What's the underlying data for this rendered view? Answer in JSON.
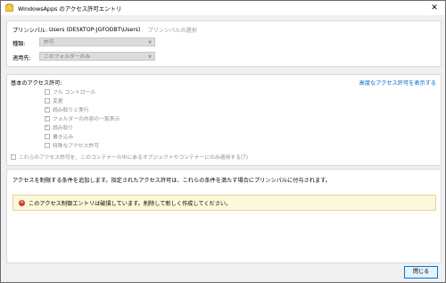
{
  "window": {
    "title": "WindowsApps のアクセス許可エントリ",
    "close_glyph": "✕"
  },
  "principal": {
    "label": "プリンシパル:",
    "value": "Users (DESKTOP-JGFODBT\\Users)",
    "select_link": "プリンシパルの選択"
  },
  "type": {
    "label": "種類:",
    "value": "許可"
  },
  "applies_to": {
    "label": "適用先:",
    "value": "このフォルダーのみ"
  },
  "basic_permissions": {
    "heading": "基本のアクセス許可:",
    "advanced_link": "高度なアクセス許可を表示する",
    "items": [
      {
        "label": "フル コントロール",
        "checked": false
      },
      {
        "label": "変更",
        "checked": false
      },
      {
        "label": "読み取りと実行",
        "checked": true
      },
      {
        "label": "フォルダーの内容の一覧表示",
        "checked": true
      },
      {
        "label": "読み取り",
        "checked": true
      },
      {
        "label": "書き込み",
        "checked": false
      },
      {
        "label": "特殊なアクセス許可",
        "checked": false
      }
    ],
    "apply_only_label": "これらのアクセス許可を、このコンテナーの中にあるオブジェクトやコンテナーにのみ適用する(T)"
  },
  "conditions": {
    "description": "アクセスを制限する条件を追加します。指定されたアクセス許可は、これらの条件を満たす場合にプリンシパルに付与されます。",
    "error_message": "このアクセス制御エントリは破損しています。削除して新しく作成してください。"
  },
  "buttons": {
    "close": "閉じる"
  }
}
